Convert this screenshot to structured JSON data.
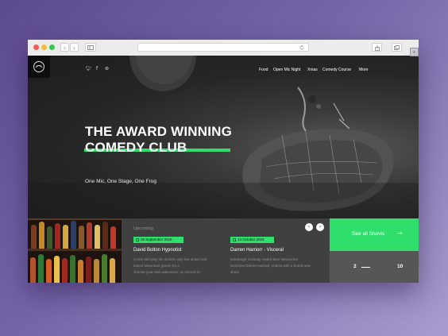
{
  "browser": {
    "traffic_lights": [
      "#f25c54",
      "#f5bd3a",
      "#38c548"
    ],
    "back_icon": "chevron-left-icon",
    "forward_icon": "chevron-right-icon"
  },
  "site": {
    "social": [
      "twitter-icon",
      "facebook-icon",
      "tripadvisor-icon"
    ],
    "nav": [
      "Food",
      "Open Mic Night",
      "Xmas",
      "Comedy Course",
      "More"
    ],
    "hero": {
      "line1": "THE AWARD WINNING",
      "line2": "COMEDY CLUB",
      "tagline": "One Mic, One Stage, One Frog"
    },
    "upcoming": {
      "label": "Upcoming",
      "events": [
        {
          "date": "26 September 2018",
          "title": "David Bolton Hypnotist",
          "desc_lines": [
            "Come and play the world's only live-action text",
            "based adventure game! It's a",
            "choose-your-own-adventure, so choose it!"
          ]
        },
        {
          "date": "14 October 2018",
          "title": "Darren Harriorr - Visceral",
          "desc_lines": [
            "Edinburgh Comedy Award Best Newcomer",
            "Nominee Darren Harriott, returns with a brand new",
            "show."
          ]
        }
      ]
    },
    "cta": {
      "label": "See all Shows",
      "arrow": "→"
    },
    "pager": {
      "current": "2",
      "total": "10"
    },
    "accent": "#2ee06b"
  }
}
